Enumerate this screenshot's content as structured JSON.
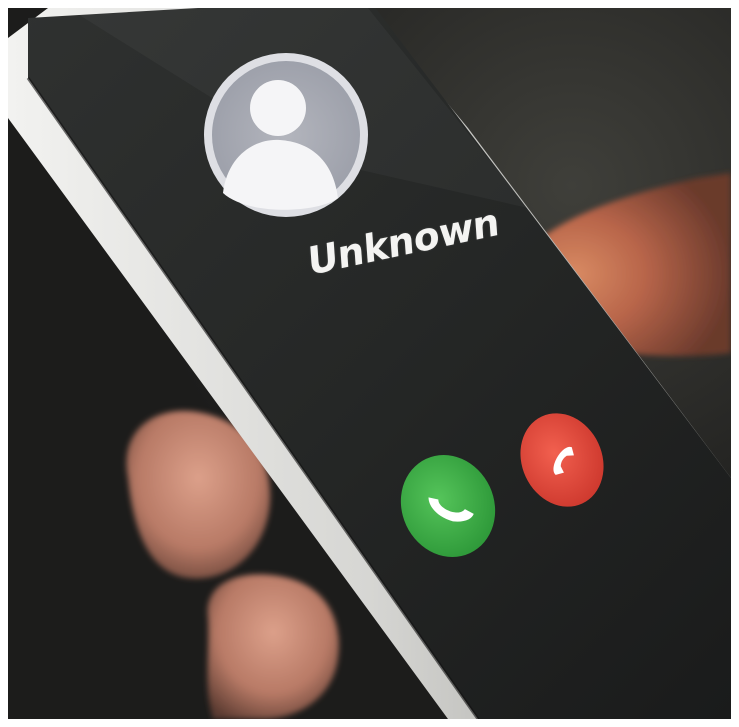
{
  "incoming_call": {
    "caller_name": "Unknown",
    "avatar_icon": "person-silhouette-icon",
    "accept_icon": "phone-accept-icon",
    "decline_icon": "phone-decline-icon",
    "accept_color": "#3fae46",
    "decline_color": "#e8483c"
  }
}
